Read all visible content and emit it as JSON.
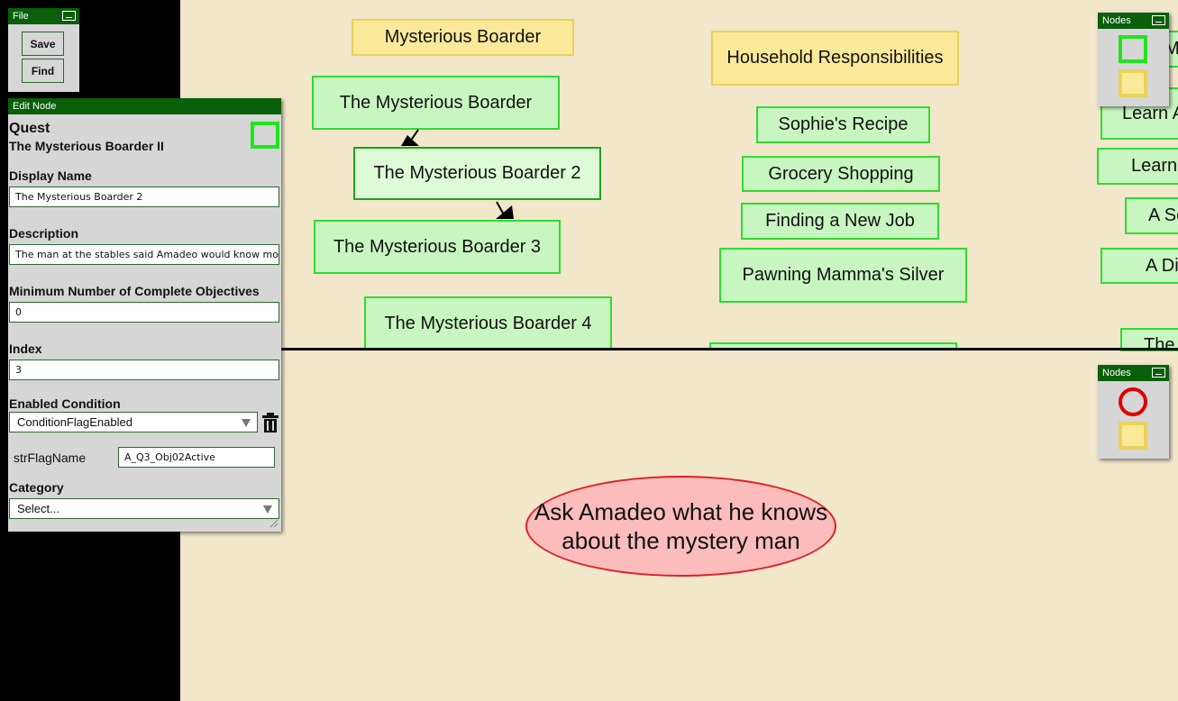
{
  "file_panel": {
    "title": "File",
    "save_label": "Save",
    "find_label": "Find"
  },
  "edit_panel": {
    "title": "Edit Node",
    "node_type": "Quest",
    "node_name": "The Mysterious Boarder II",
    "display_name_label": "Display Name",
    "display_name_value": "The Mysterious Boarder 2",
    "description_label": "Description",
    "description_value": "The man at the stables said Amadeo would know more",
    "min_objectives_label": "Minimum Number of Complete Objectives",
    "min_objectives_value": "0",
    "index_label": "Index",
    "index_value": "3",
    "enabled_condition_label": "Enabled Condition",
    "enabled_condition_value": "ConditionFlagEnabled",
    "flag_param_label": "strFlagName",
    "flag_param_value": "A_Q3_Obj02Active",
    "category_label": "Category",
    "category_value": "Select..."
  },
  "nodes_panel_top": {
    "title": "Nodes"
  },
  "nodes_panel_bottom": {
    "title": "Nodes"
  },
  "graph": {
    "group_mysterious": "Mysterious Boarder",
    "group_household": "Household Responsibilities",
    "quests": [
      "The Mysterious Boarder",
      "The Mysterious Boarder 2",
      "The Mysterious Boarder 3",
      "The Mysterious Boarder 4",
      "Sophie's Recipe",
      "Grocery Shopping",
      "Finding a New Job",
      "Pawning Mamma's Silver"
    ],
    "right_partial": [
      "Mi",
      "Learn A",
      "Learn",
      "A Se",
      "A Di",
      "The"
    ]
  },
  "objective": {
    "text": "Ask Amadeo what he knows about the mystery man"
  },
  "colors": {
    "canvas": "#f2e6cb",
    "title_bar": "#0a5f0a",
    "quest_fill": "#c8f6c0",
    "quest_border": "#2fdc2f",
    "group_fill": "#fbe99a",
    "objective_fill": "#fdbcbc",
    "objective_border": "#e02020"
  }
}
